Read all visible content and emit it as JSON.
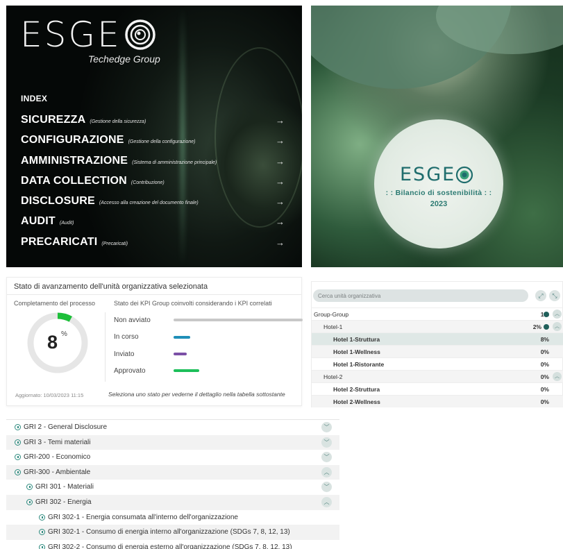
{
  "index_panel": {
    "logo_text": "ESGE",
    "tagline": "Techedge Group",
    "heading": "INDEX",
    "items": [
      {
        "label": "SICUREZZA",
        "sub": "(Gestione della sicurezza)"
      },
      {
        "label": "CONFIGURAZIONE",
        "sub": "(Gestione della configurazione)"
      },
      {
        "label": "AMMINISTRAZIONE",
        "sub": "(Sistema di amministrazione principale)"
      },
      {
        "label": "DATA COLLECTION",
        "sub": "(Contribuzione)"
      },
      {
        "label": "DISCLOSURE",
        "sub": "(Accesso alla creazione del documento finale)"
      },
      {
        "label": "AUDIT",
        "sub": "(Audit)"
      },
      {
        "label": "PRECARICATI",
        "sub": "(Precaricati)"
      }
    ],
    "arrow_glyph": "→"
  },
  "cover_panel": {
    "logo_text": "ESGE",
    "subtitle": ": : Bilancio di sostenibilità : :",
    "year": "2023"
  },
  "status_panel": {
    "title": "Stato di avanzamento dell'unità organizzativa selezionata",
    "left_heading": "Completamento del processo",
    "right_heading": "Stato dei KPI Group coinvolti considerando i KPI correlati",
    "completion_value": "8",
    "completion_fraction": 0.08,
    "completion_unit": "%",
    "legend": [
      {
        "label": "Non avviato",
        "color": "#c8c8c8"
      },
      {
        "label": "In corso",
        "color": "#1f8fb8"
      },
      {
        "label": "Inviato",
        "color": "#7b4fa6"
      },
      {
        "label": "Approvato",
        "color": "#1dbf5a"
      }
    ],
    "updated": "Aggiornato: 10/03/2023 11:15",
    "hint": "Seleziona uno stato per vederne il dettaglio nella tabella sottostante",
    "accent": "#1dbf3a"
  },
  "org_panel": {
    "search_placeholder": "Cerca unità organizzativa",
    "expand_icon": "⤢",
    "collapse_icon": "⤡",
    "rows": [
      {
        "label": "Group-Group",
        "value": "1%"
      },
      {
        "label": "Hotel-1",
        "value": "2%"
      },
      {
        "label": "Hotel 1-Struttura",
        "value": "8%"
      },
      {
        "label": "Hotel 1-Wellness",
        "value": "0%"
      },
      {
        "label": "Hotel 1-Ristorante",
        "value": "0%"
      },
      {
        "label": "Hotel-2",
        "value": "0%"
      },
      {
        "label": "Hotel 2-Struttura",
        "value": "0%"
      },
      {
        "label": "Hotel 2-Wellness",
        "value": "0%"
      }
    ]
  },
  "gri_panel": {
    "rows": [
      {
        "label": "GRI 2 - General Disclosure",
        "chevron": "down"
      },
      {
        "label": "GRI 3 - Temi materiali",
        "chevron": "down"
      },
      {
        "label": "GRI-200 - Economico",
        "chevron": "down"
      },
      {
        "label": "GRI-300 - Ambientale",
        "chevron": "up"
      },
      {
        "label": "GRI 301 - Materiali",
        "chevron": "down"
      },
      {
        "label": "GRI 302 - Energia",
        "chevron": "up"
      },
      {
        "label": "GRI 302-1 - Energia consumata all'interno dell'organizzazione",
        "chevron": ""
      },
      {
        "label": "GRI 302-1 - Consumo di energia interno all'organizzazione (SDGs 7, 8, 12, 13)",
        "chevron": ""
      },
      {
        "label": "GRI 302-2 - Consumo di energia esterno all'organizzazione (SDGs 7, 8, 12, 13)",
        "chevron": ""
      }
    ]
  }
}
